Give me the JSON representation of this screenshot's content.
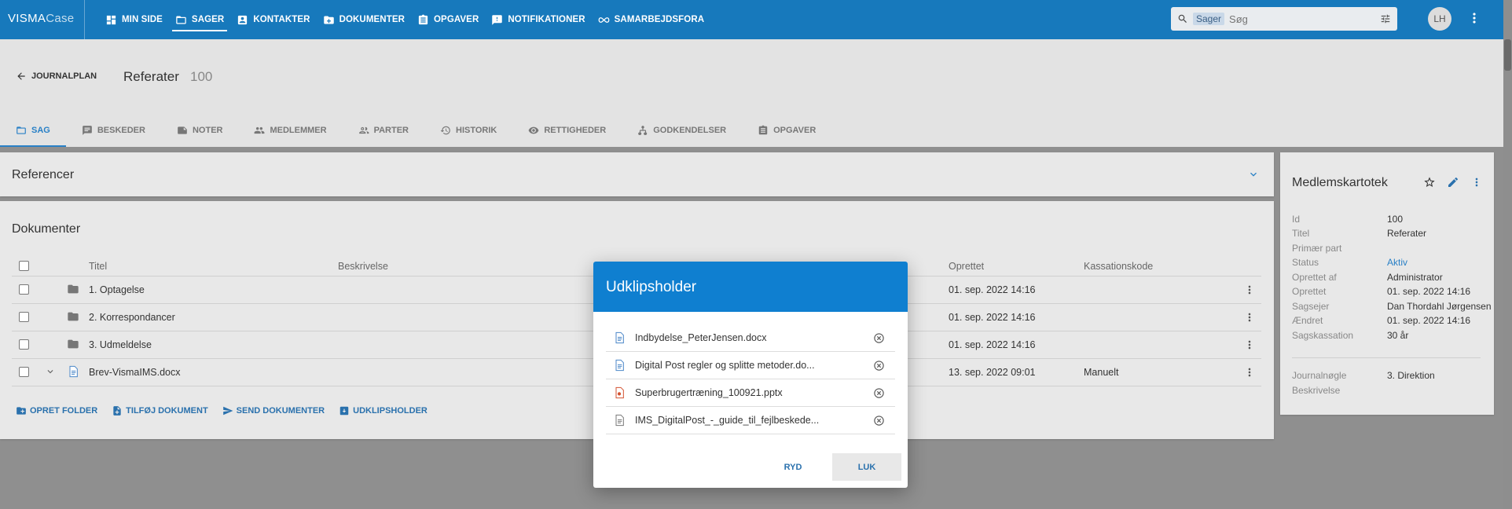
{
  "brand": {
    "visma": "VISMA",
    "case": "Case"
  },
  "nav": [
    {
      "label": "MIN SIDE",
      "icon": "dashboard-icon"
    },
    {
      "label": "SAGER",
      "icon": "folder-icon",
      "active": true
    },
    {
      "label": "KONTAKTER",
      "icon": "contact-icon"
    },
    {
      "label": "DOKUMENTER",
      "icon": "documents-icon"
    },
    {
      "label": "OPGAVER",
      "icon": "clipboard-icon"
    },
    {
      "label": "NOTIFIKATIONER",
      "icon": "notification-icon"
    },
    {
      "label": "SAMARBEJDSFORA",
      "icon": "link-icon"
    }
  ],
  "search": {
    "chip": "Sager",
    "placeholder": "Søg"
  },
  "user": {
    "initials": "LH"
  },
  "header": {
    "back_label": "JOURNALPLAN",
    "title": "Referater",
    "number": "100"
  },
  "tabs": [
    {
      "label": "SAG",
      "icon": "folder-icon",
      "active": true
    },
    {
      "label": "BESKEDER",
      "icon": "message-icon"
    },
    {
      "label": "NOTER",
      "icon": "note-icon"
    },
    {
      "label": "MEDLEMMER",
      "icon": "people-icon"
    },
    {
      "label": "PARTER",
      "icon": "parties-icon"
    },
    {
      "label": "HISTORIK",
      "icon": "history-icon"
    },
    {
      "label": "RETTIGHEDER",
      "icon": "eye-icon"
    },
    {
      "label": "GODKENDELSER",
      "icon": "tree-icon"
    },
    {
      "label": "OPGAVER",
      "icon": "clipboard-icon"
    }
  ],
  "references": {
    "title": "Referencer"
  },
  "documents": {
    "title": "Dokumenter",
    "columns": {
      "title": "Titel",
      "description": "Beskrivelse",
      "created": "Oprettet",
      "disposal": "Kassationskode"
    },
    "rows": [
      {
        "title": "1. Optagelse",
        "created": "01. sep. 2022 14:16",
        "disposal": "",
        "type": "folder"
      },
      {
        "title": "2. Korrespondancer",
        "created": "01. sep. 2022 14:16",
        "disposal": "",
        "type": "folder"
      },
      {
        "title": "3. Udmeldelse",
        "created": "01. sep. 2022 14:16",
        "disposal": "",
        "type": "folder"
      },
      {
        "title": "Brev-VismaIMS.docx",
        "created": "13. sep. 2022 09:01",
        "disposal": "Manuelt",
        "type": "word"
      }
    ],
    "actions": [
      "OPRET FOLDER",
      "TILFØJ DOKUMENT",
      "SEND DOKUMENTER",
      "UDKLIPSHOLDER"
    ]
  },
  "side": {
    "title": "Medlemskartotek",
    "fields": [
      {
        "k": "Id",
        "v": "100"
      },
      {
        "k": "Titel",
        "v": "Referater"
      },
      {
        "k": "Primær part",
        "v": ""
      },
      {
        "k": "Status",
        "v": "Aktiv",
        "link": true
      },
      {
        "k": "Oprettet af",
        "v": "Administrator"
      },
      {
        "k": "Oprettet",
        "v": "01. sep. 2022 14:16"
      },
      {
        "k": "Sagsejer",
        "v": "Dan Thordahl Jørgensen"
      },
      {
        "k": "Ændret",
        "v": "01. sep. 2022 14:16"
      },
      {
        "k": "Sagskassation",
        "v": "30 år"
      }
    ],
    "fields2": [
      {
        "k": "Journalnøgle",
        "v": "3. Direktion"
      },
      {
        "k": "Beskrivelse",
        "v": ""
      }
    ]
  },
  "modal": {
    "title": "Udklipsholder",
    "items": [
      {
        "name": "Indbydelse_PeterJensen.docx",
        "type": "word"
      },
      {
        "name": "Digital Post regler og splitte metoder.do...",
        "type": "word"
      },
      {
        "name": "Superbrugertræning_100921.pptx",
        "type": "powerpoint"
      },
      {
        "name": "IMS_DigitalPost_-_guide_til_fejlbeskede...",
        "type": "text"
      }
    ],
    "btn_clear": "RYD",
    "btn_close": "LUK"
  },
  "colors": {
    "topbar": "#1779bc",
    "accent": "#2980c6",
    "modal_header": "#0f7fd0",
    "backdrop": "#8f8f8f"
  }
}
